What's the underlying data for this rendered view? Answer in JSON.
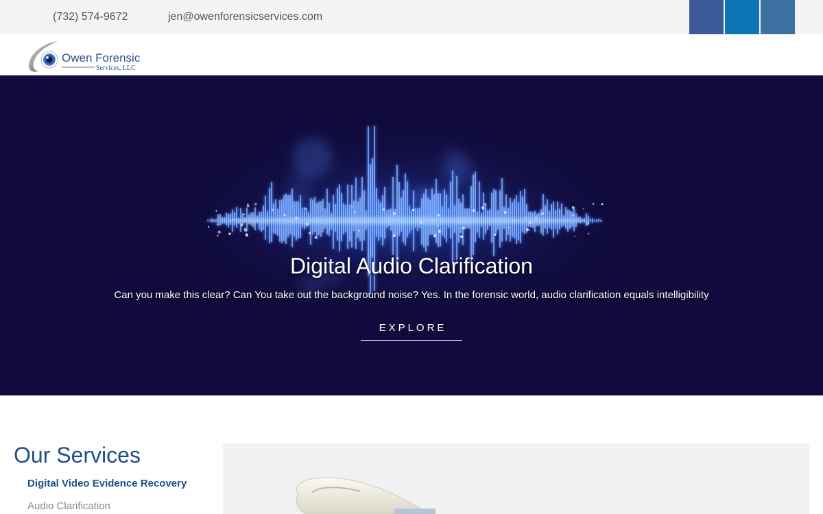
{
  "topbar": {
    "phone": "(732) 574-9672",
    "email": "jen@owenforensicservices.com",
    "social": [
      {
        "name": "facebook-icon",
        "color": "#3b5998"
      },
      {
        "name": "linkedin-icon",
        "color": "#0e76b8"
      },
      {
        "name": "social-link-icon",
        "color": "#3d6fa0"
      }
    ]
  },
  "header": {
    "logo_name": "Owen Forensic",
    "logo_sub": "Services, LLC"
  },
  "hero": {
    "title": "Digital Audio Clarification",
    "text": "Can you make this clear? Can You take out the background noise? Yes. In the forensic world, audio clarification equals intelligibility",
    "button": "EXPLORE",
    "background_color": "#110b3d"
  },
  "services": {
    "title": "Our Services",
    "items": [
      {
        "label": "Digital Video Evidence Recovery",
        "active": true
      },
      {
        "label": "Audio Clarification",
        "active": false
      }
    ]
  },
  "colors": {
    "brand_blue": "#1f4e8c",
    "topbar_bg": "#f4f4f4"
  }
}
